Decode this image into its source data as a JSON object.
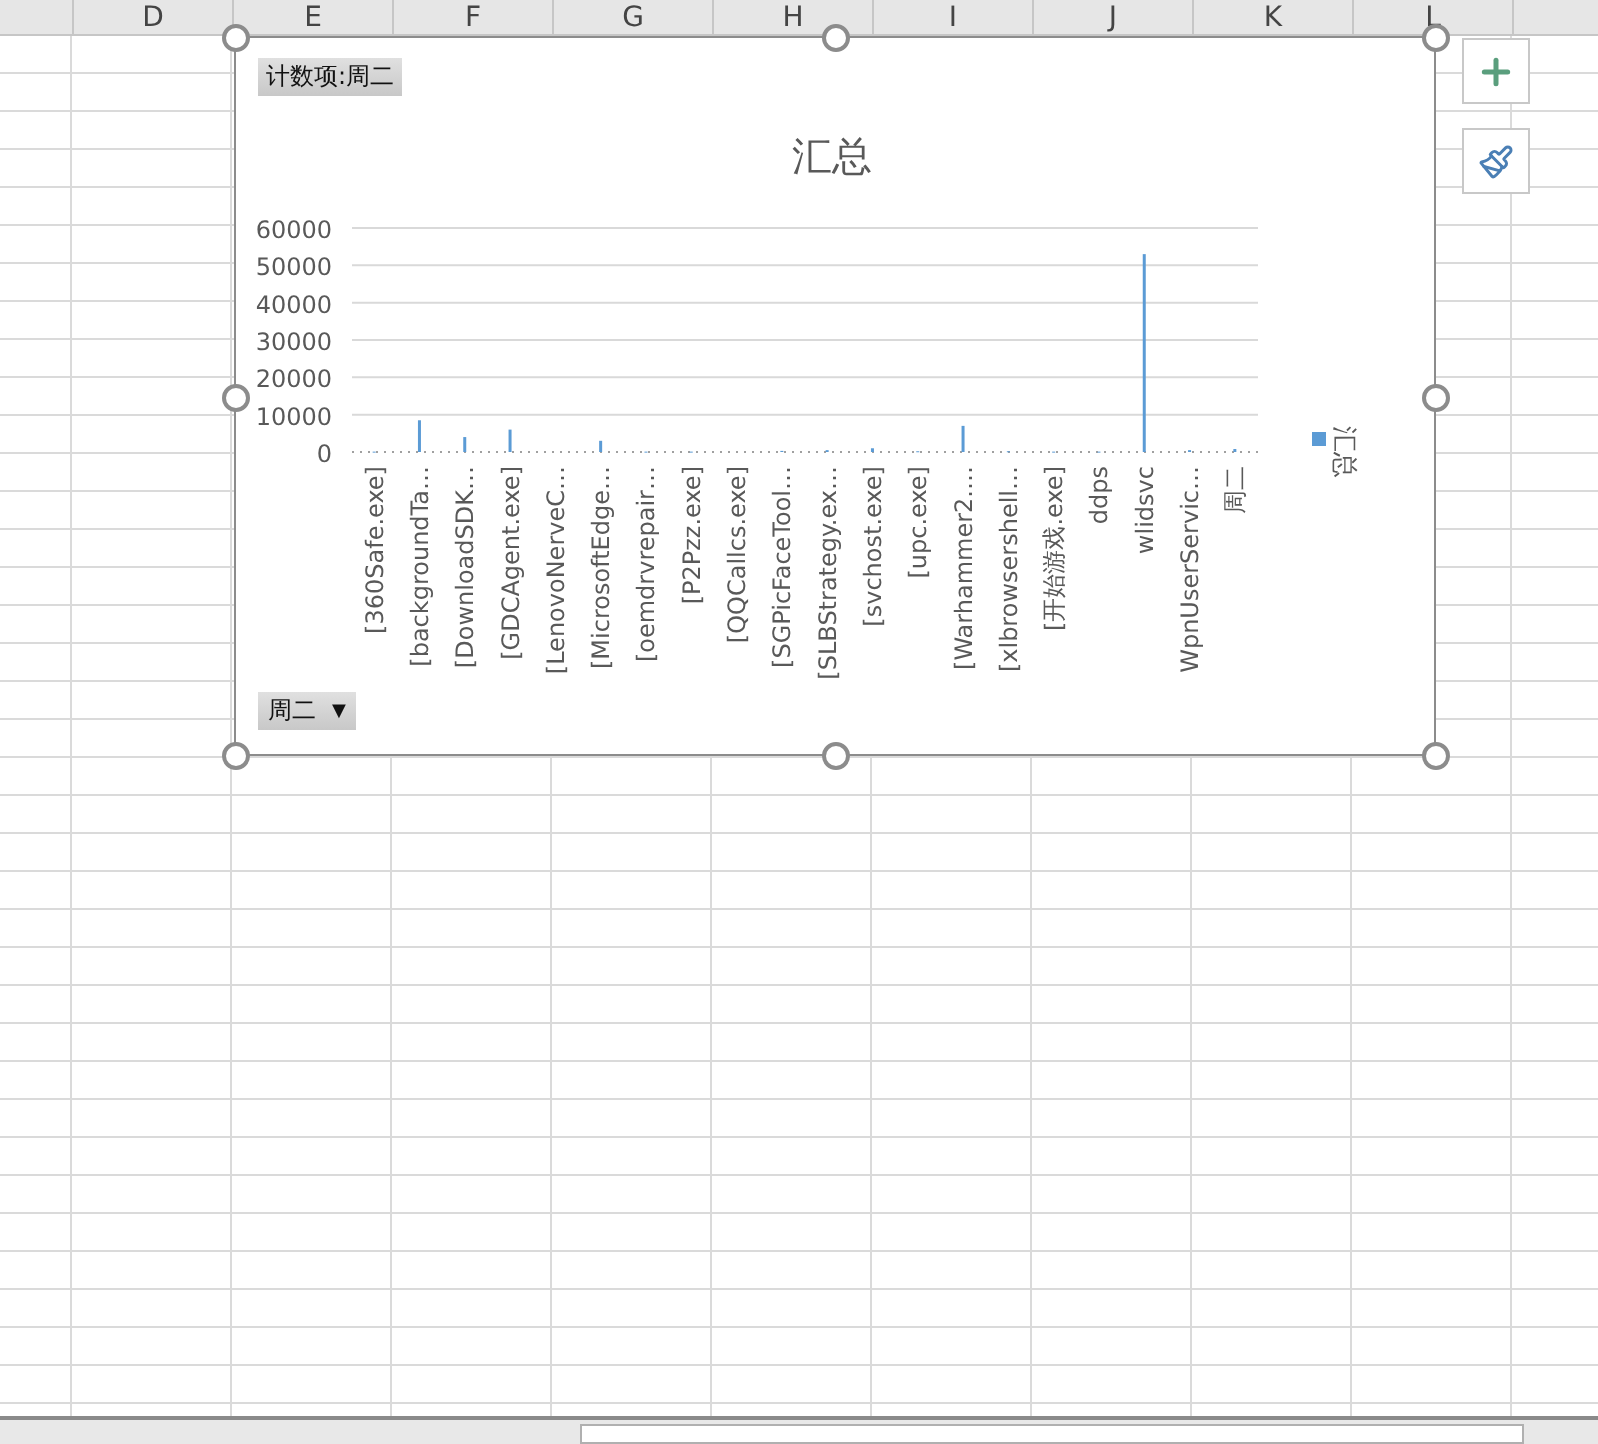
{
  "columns": [
    "D",
    "E",
    "F",
    "G",
    "H",
    "I",
    "J",
    "K",
    "L"
  ],
  "chart": {
    "value_field_button": "计数项:周二",
    "filter_button": {
      "label": "周二",
      "arrow": "▼"
    },
    "chart_data": {
      "type": "bar",
      "grid": true,
      "title": "汇总",
      "ylim": [
        0,
        60000
      ],
      "yticks": [
        0,
        10000,
        20000,
        30000,
        40000,
        50000,
        60000
      ],
      "categories": [
        "[360Safe.exe]",
        "[backgroundTa…",
        "[DownloadSDK…",
        "[GDCAgent.exe]",
        "[LenovoNerveC…",
        "[MicrosoftEdge…",
        "[oemdrvrepair…",
        "[P2Pzz.exe]",
        "[QQCallcs.exe]",
        "[SGPicFaceTool…",
        "[SLBStrategy.ex…",
        "[svchost.exe]",
        "[upc.exe]",
        "[Warhammer2.…",
        "[xlbrowsershell…",
        "[开始游戏.exe]",
        "ddps",
        "wlidsvc",
        "WpnUserServic…",
        "周二"
      ],
      "series": [
        {
          "name": "汇总",
          "color": "#5b9bd5",
          "values": [
            100,
            8500,
            4000,
            6000,
            null,
            3000,
            100,
            100,
            null,
            300,
            500,
            1000,
            200,
            7000,
            200,
            100,
            100,
            53000,
            500,
            800
          ]
        }
      ]
    }
  }
}
